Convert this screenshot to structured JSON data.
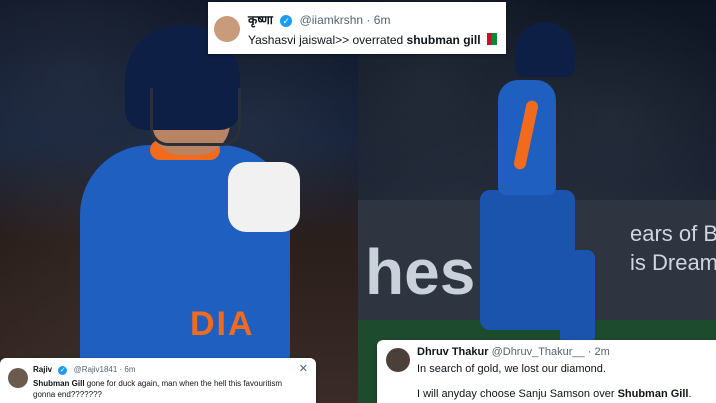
{
  "tweets": {
    "top": {
      "name": "कृष्णा",
      "handle": "@iiamkrshn",
      "time": "· 6m",
      "text_prefix": "Yashasvi jaiswal>> overrated ",
      "text_bold": "shubman gill",
      "emoji": "flag-icon"
    },
    "left": {
      "name": "Rajiv",
      "handle": "@Rajiv1841",
      "time": "· 6m",
      "text_bold": "Shubman Gill",
      "text_rest": " gone for duck again, man when the hell this favouritism gonna end???????"
    },
    "right": {
      "name": "Dhruv Thakur",
      "handle": "@Dhruv_Thakur__",
      "time": "· 2m",
      "line1": "In search of gold, we lost our diamond.",
      "line2_prefix": "I will anyday choose Sanju Samson over ",
      "line2_bold": "Shubman Gill",
      "line2_suffix": "."
    }
  },
  "photo": {
    "left_jersey_text": "DIA",
    "right_board_word": "hes",
    "right_board_text": "ears of Bu\nis Dream"
  },
  "colors": {
    "india_blue": "#1f5fbf",
    "india_orange": "#f26b1d",
    "verified_blue": "#1d9bf0"
  }
}
